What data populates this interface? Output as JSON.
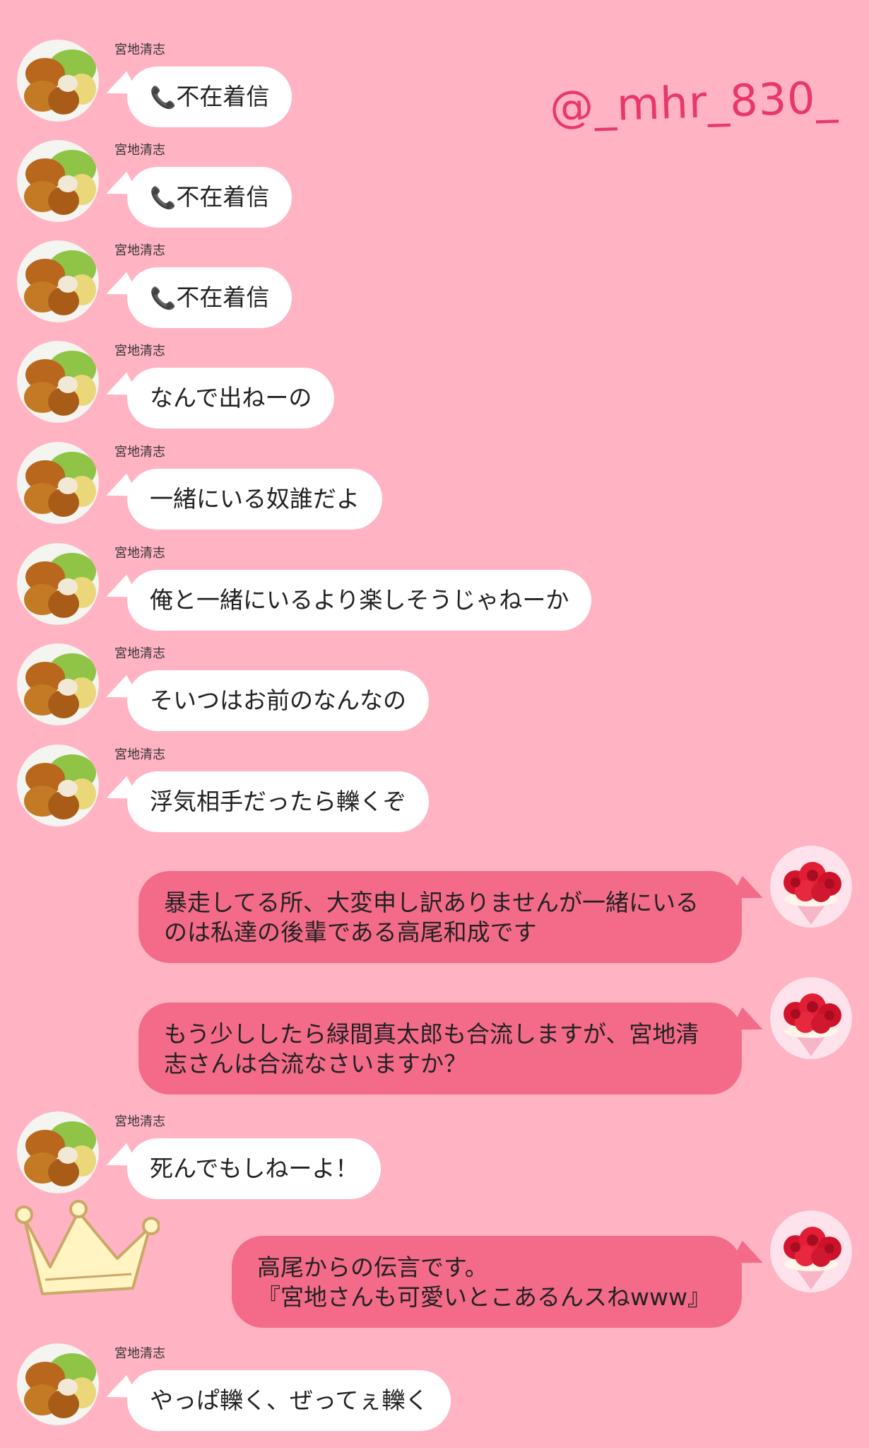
{
  "watermark": "@_mhr_830_",
  "sender_name": "宮地清志",
  "messages": [
    {
      "text": "不在着信",
      "call_icon": "phone-icon"
    },
    {
      "text": "不在着信",
      "call_icon": "phone-icon"
    },
    {
      "text": "不在着信",
      "call_icon": "phone-icon"
    },
    {
      "text": "なんで出ねーの"
    },
    {
      "text": "一緒にいる奴誰だよ"
    },
    {
      "text": "俺と一緒にいるより楽しそうじゃねーか"
    },
    {
      "text": "そいつはお前のなんなの"
    },
    {
      "text": "浮気相手だったら轢くぞ"
    },
    {
      "line1": "暴走してる所、大変申し訳ありませんが一緒にいる",
      "line2": "のは私達の後輩である高尾和成です"
    },
    {
      "line1": "もう少ししたら緑間真太郎も合流しますが、宮地清",
      "line2": "志さんは合流なさいますか？"
    },
    {
      "text": "死んでもしねーよ！"
    },
    {
      "line1": "高尾からの伝言です。",
      "line2": "『宮地さんも可愛いとこあるんスねwww』"
    },
    {
      "text": "やっぱ轢く、ぜってぇ轢く"
    }
  ],
  "colors": {
    "background": "#ffb3c3",
    "outgoing_bubble": "#f36b89",
    "incoming_bubble": "#ffffff",
    "watermark": "#e8386a"
  }
}
